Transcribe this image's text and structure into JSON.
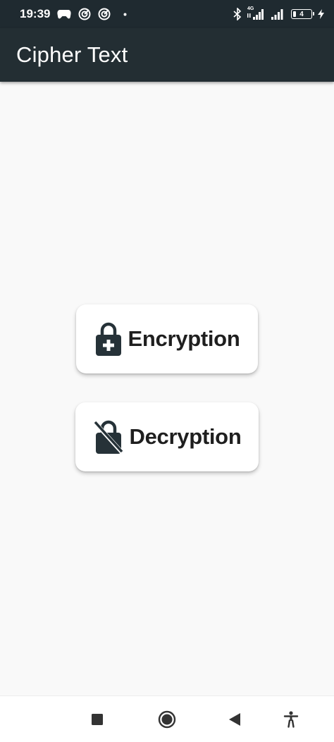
{
  "status_bar": {
    "time": "19:39",
    "network_type": "4G",
    "battery_level": "4",
    "icons": [
      "gamepad-icon",
      "target-icon",
      "target-icon",
      "dot-icon",
      "bluetooth-icon",
      "signal-icon",
      "signal-icon",
      "battery-icon",
      "charging-bolt-icon"
    ]
  },
  "app_bar": {
    "title": "Cipher Text"
  },
  "actions": {
    "encrypt": {
      "label": "Encryption",
      "icon": "lock-plus-icon"
    },
    "decrypt": {
      "label": "Decryption",
      "icon": "lock-off-icon"
    }
  },
  "nav_bar": {
    "icons": [
      "recents-square-icon",
      "home-circle-icon",
      "back-triangle-icon",
      "accessibility-icon"
    ]
  },
  "colors": {
    "app_bar": "#232e33",
    "status_bar": "#1f2a30",
    "background": "#f9f9f9",
    "card": "#ffffff",
    "text_dark": "#1f1f1f",
    "icon_dark": "#263238"
  }
}
